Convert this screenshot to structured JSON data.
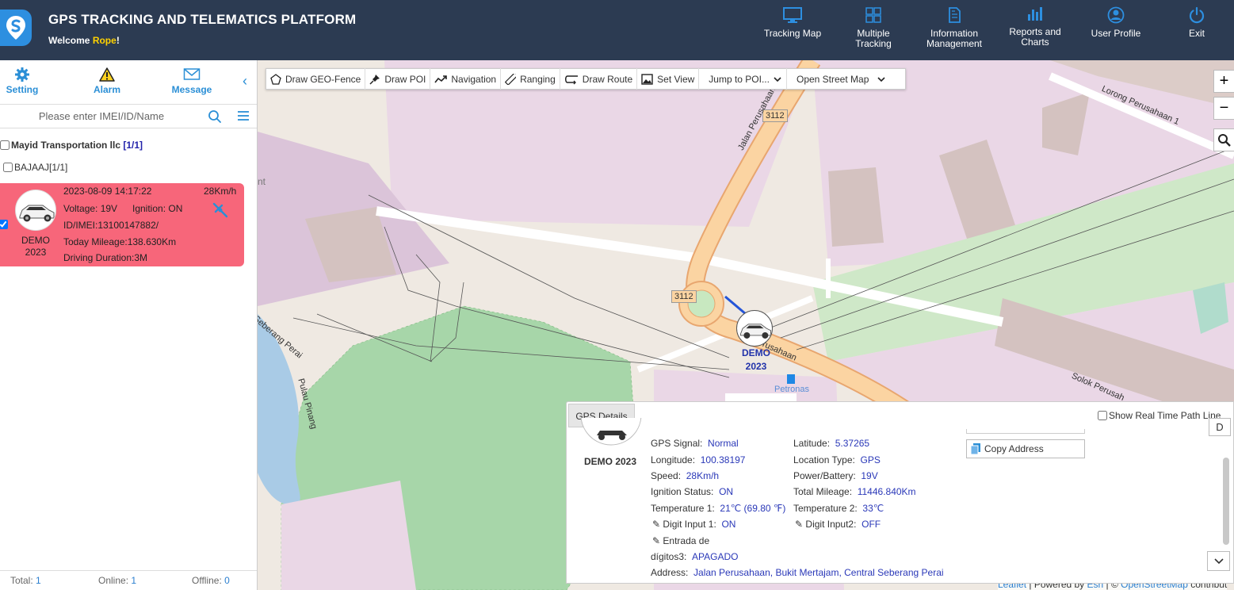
{
  "header": {
    "title": "GPS TRACKING AND TELEMATICS PLATFORM",
    "welcome_prefix": "Welcome",
    "user": "Rope",
    "welcome_suffix": "!",
    "nav": [
      {
        "label": "Tracking Map",
        "icon": "monitor-icon"
      },
      {
        "label": "Multiple\nTracking",
        "icon": "grid-icon"
      },
      {
        "label": "Information\nManagement",
        "icon": "document-icon"
      },
      {
        "label": "Reports and\nCharts",
        "icon": "bar-chart-icon"
      },
      {
        "label": "User Profile",
        "icon": "user-icon"
      },
      {
        "label": "Exit",
        "icon": "power-icon"
      }
    ]
  },
  "sidebar": {
    "tabs": [
      {
        "label": "Setting",
        "icon": "gear-icon"
      },
      {
        "label": "Alarm",
        "icon": "warning-icon"
      },
      {
        "label": "Message",
        "icon": "envelope-icon"
      }
    ],
    "search_placeholder": "Please enter IMEI/ID/Name",
    "group": {
      "name": "Mayid Transportation llc",
      "count": "[1/1]"
    },
    "subgroup": "BAJAAJ[1/1]",
    "device": {
      "name": "DEMO 2023",
      "timestamp": "2023-08-09 14:17:22",
      "speed": "28Km/h",
      "voltage": "Voltage: 19V",
      "ignition": "Ignition: ON",
      "imei": "ID/IMEI:13100147882/",
      "mileage": "Today Mileage:138.630Km",
      "duration": "Driving Duration:3M"
    },
    "footer": {
      "total_label": "Total:",
      "total": "1",
      "online_label": "Online:",
      "online": "1",
      "offline_label": "Offline:",
      "offline": "0"
    }
  },
  "toolbar": {
    "items": [
      {
        "label": "Draw GEO-Fence",
        "icon": "pentagon-icon"
      },
      {
        "label": "Draw POI",
        "icon": "pin-icon"
      },
      {
        "label": "Navigation",
        "icon": "route-icon"
      },
      {
        "label": "Ranging",
        "icon": "ruler-icon"
      },
      {
        "label": "Draw Route",
        "icon": "draw-route-icon"
      },
      {
        "label": "Set View",
        "icon": "image-icon"
      },
      {
        "label": "Jump to POI...",
        "icon": "chevron-down-icon"
      },
      {
        "label": "Open Street Map",
        "icon": "chevron-down-icon"
      }
    ]
  },
  "map": {
    "road_labels": [
      "3112",
      "3112",
      "Jalan Perusahaan",
      "Lorong Perusahaan 1",
      "Solok Perusah",
      "Perai",
      "Pulau Pinang",
      "Seberang Perai",
      "nt"
    ],
    "road_number": "3112",
    "road_jalan": "Jalan Perusahaan",
    "road_lorong": "Lorong Perusahaan 1",
    "road_solok": "Solok Perusah",
    "road_usahaan": "rusahaan",
    "place_pulau": "Pulau Pinang",
    "place_seberang": "Seberang Perai",
    "place_nt": "nt",
    "poi": "Petronas",
    "marker_label": "DEMO\n2023",
    "zoom_in": "+",
    "zoom_out": "−",
    "attrib_leaflet": "Leaflet",
    "attrib_mid": " | Powered by ",
    "attrib_esri": "Esri",
    "attrib_sep": " | © ",
    "attrib_osm": "OpenStreetMap",
    "attrib_end": " contribut"
  },
  "gps": {
    "tab": "GPS Details",
    "realtime": "Show Real Time Path Line",
    "d_button": "D",
    "device_name": "DEMO 2023",
    "copy_address": "Copy Address",
    "fields": {
      "signal_label": "GPS Signal:",
      "signal": "Normal",
      "lat_label": "Latitude:",
      "lat": "5.37265",
      "lon_label": "Longitude:",
      "lon": "100.38197",
      "loctype_label": "Location Type:",
      "loctype": "GPS",
      "speed_label": "Speed:",
      "speed": "28Km/h",
      "power_label": "Power/Battery:",
      "power": "19V",
      "ign_label": "Ignition Status:",
      "ign": "ON",
      "mileage_label": "Total Mileage:",
      "mileage": "11446.840Km",
      "t1_label": "Temperature 1:",
      "t1": "21℃ (69.80 ℉)",
      "t2_label": "Temperature 2:",
      "t2": "33℃",
      "di1_label": "Digit Input 1:",
      "di1": "ON",
      "di2_label": "Digit Input2:",
      "di2": "OFF",
      "di3_label_a": "Entrada de",
      "di3_label_b": "dígitos3:",
      "di3": "APAGADO",
      "addr_label": "Address:",
      "addr": "Jalan Perusahaan, Bukit Mertajam, Central Seberang Perai"
    }
  }
}
